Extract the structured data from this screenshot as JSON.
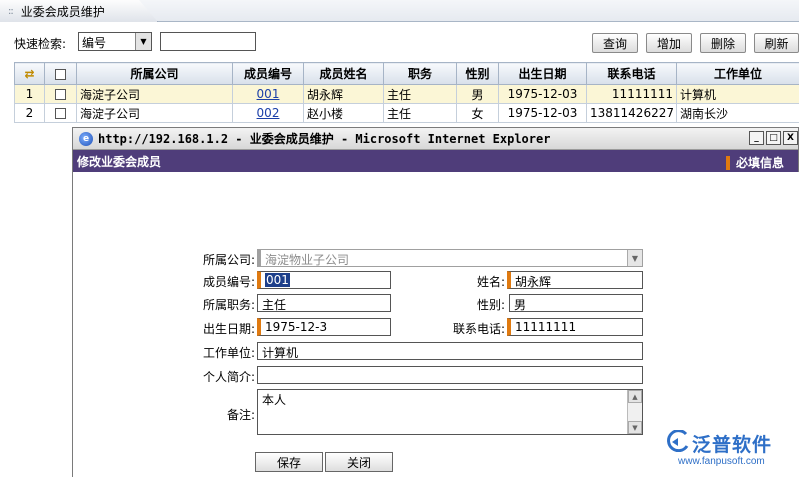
{
  "tab": {
    "grip": "::",
    "title": "业委会成员维护"
  },
  "toolbar": {
    "quick_search_label": "快速检索:",
    "search_field_select": "编号",
    "search_value": "",
    "buttons": {
      "query": "查询",
      "add": "增加",
      "delete": "删除",
      "refresh": "刷新"
    }
  },
  "grid": {
    "columns": [
      "所属公司",
      "成员编号",
      "成员姓名",
      "职务",
      "性别",
      "出生日期",
      "联系电话",
      "工作单位"
    ],
    "rows": [
      {
        "index": "1",
        "company": "海淀子公司",
        "member_no": "001",
        "name": "胡永辉",
        "position": "主任",
        "gender": "男",
        "birth_date": "1975-12-03",
        "phone": "11111111",
        "work_unit": "计算机"
      },
      {
        "index": "2",
        "company": "海淀子公司",
        "member_no": "002",
        "name": "赵小楼",
        "position": "主任",
        "gender": "女",
        "birth_date": "1975-12-03",
        "phone": "13811426227",
        "work_unit": "湖南长沙"
      }
    ]
  },
  "dialog": {
    "window_title": "http://192.168.1.2 - 业委会成员维护 - Microsoft Internet Explorer",
    "window_buttons": {
      "minimize": "_",
      "maximize": "□",
      "close": "X"
    },
    "header": "修改业委会成员",
    "required_note": "必填信息",
    "form": {
      "company_label": "所属公司:",
      "company_value": "海淀物业子公司",
      "member_no_label": "成员编号:",
      "member_no_value": "001",
      "name_label": "姓名:",
      "name_value": "胡永辉",
      "position_label": "所属职务:",
      "position_value": "主任",
      "gender_label": "性别:",
      "gender_value": "男",
      "birth_label": "出生日期:",
      "birth_value": "1975-12-3",
      "phone_label": "联系电话:",
      "phone_value": "11111111",
      "work_unit_label": "工作单位:",
      "work_unit_value": "计算机",
      "bio_label": "个人简介:",
      "bio_value": "",
      "remark_label": "备注:",
      "remark_value": "本人"
    },
    "buttons": {
      "save": "保存",
      "close": "关闭"
    }
  },
  "watermark": {
    "name": "泛普软件",
    "url": "www.fanpusoft.com"
  },
  "colors": {
    "banner": "#4f3d7a",
    "required_marker": "#e07a10",
    "selected_row": "#fbf6d6",
    "link": "#1b3fa8"
  }
}
